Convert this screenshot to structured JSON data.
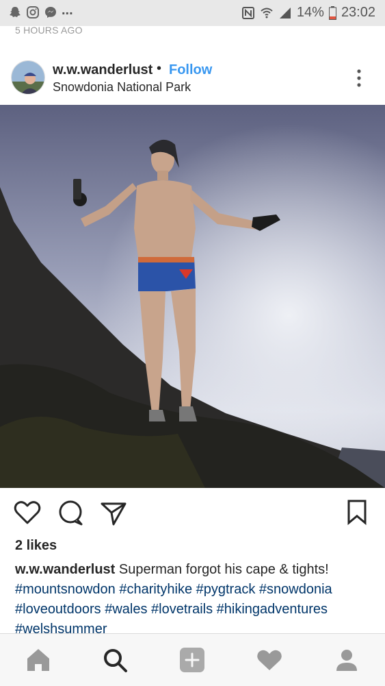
{
  "status_bar": {
    "battery": "14%",
    "time": "23:02",
    "overflow": "...",
    "icons": [
      "snapchat-icon",
      "instagram-icon",
      "messenger-icon",
      "nfc-icon",
      "wifi-icon",
      "signal-icon",
      "battery-icon"
    ]
  },
  "previous_post": {
    "timestamp": "5 HOURS AGO"
  },
  "post": {
    "username": "w.w.wanderlust",
    "separator": "•",
    "follow_label": "Follow",
    "location": "Snowdonia National Park",
    "likes": "2 likes",
    "caption_user": "w.w.wanderlust",
    "caption_text": "Superman forgot his cape & tights!",
    "hashtags": [
      "#mountsnowdon",
      "#charityhike",
      "#pygtrack",
      "#snowdonia",
      "#loveoutdoors",
      "#wales",
      "#lovetrails",
      "#hikingadventures",
      "#welshsummer"
    ]
  },
  "actions": [
    "heart-icon",
    "comment-icon",
    "share-icon",
    "bookmark-icon"
  ],
  "nav": [
    "home-icon",
    "search-icon",
    "add-icon",
    "activity-icon",
    "profile-icon"
  ],
  "colors": {
    "accent": "#3897f0",
    "hashtag": "#003569",
    "text": "#262626",
    "muted": "#999999"
  }
}
